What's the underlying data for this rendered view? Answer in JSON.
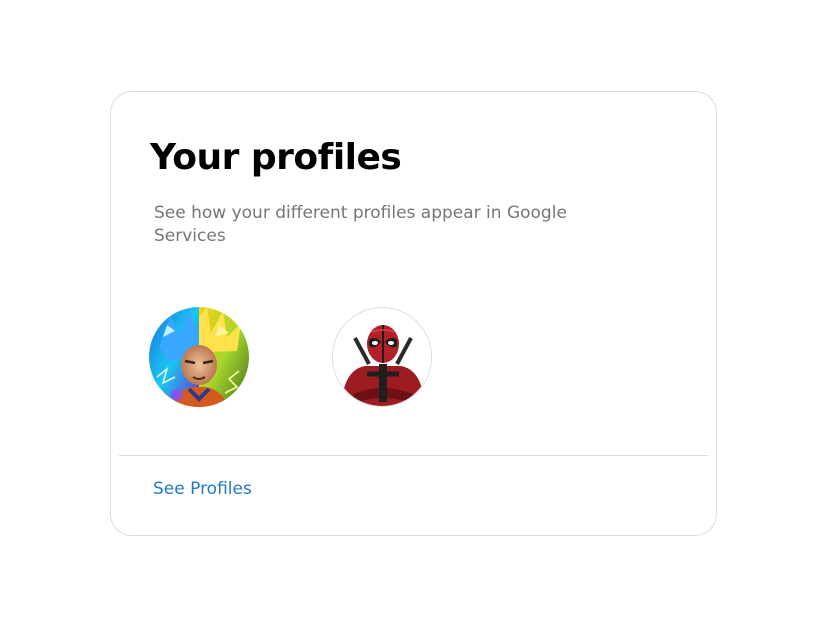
{
  "card": {
    "title": "Your profiles",
    "subtitle": "See how your different profiles appear in Google Services",
    "link_label": "See Profiles"
  },
  "profiles": [
    {
      "icon": "profile-avatar-anime-warrior-icon"
    },
    {
      "icon": "profile-avatar-masked-hero-icon"
    }
  ],
  "colors": {
    "title": "#000000",
    "subtitle": "#767676",
    "link": "#1f7ac8",
    "border": "#dadce0"
  }
}
